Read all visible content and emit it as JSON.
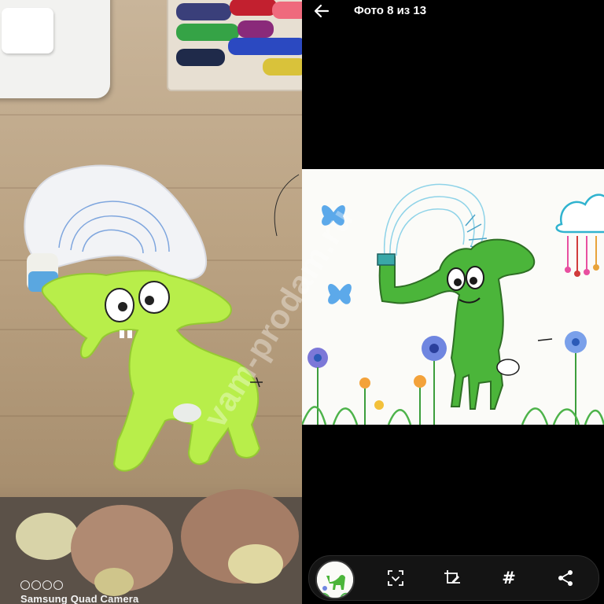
{
  "camera": {
    "watermark": "Samsung Quad Camera",
    "icon": "quad-lens-icon"
  },
  "viewer": {
    "title": "Фото 8 из 13",
    "back_icon": "arrow-left-icon"
  },
  "toolbar": {
    "items": [
      {
        "name": "thumbnail",
        "icon": "drawing-thumbnail"
      },
      {
        "name": "scan",
        "icon": "scan-icon"
      },
      {
        "name": "edit",
        "icon": "crop-edit-icon"
      },
      {
        "name": "hashtag",
        "icon": "hashtag-icon",
        "glyph": "#"
      },
      {
        "name": "share",
        "icon": "share-icon"
      }
    ]
  },
  "watermark": "vam-prodam.ru",
  "colors": {
    "background": "#000000",
    "toolbar": "#141414",
    "plush_green": "#b8ee4a",
    "drawing_green": "#4bb53a"
  }
}
